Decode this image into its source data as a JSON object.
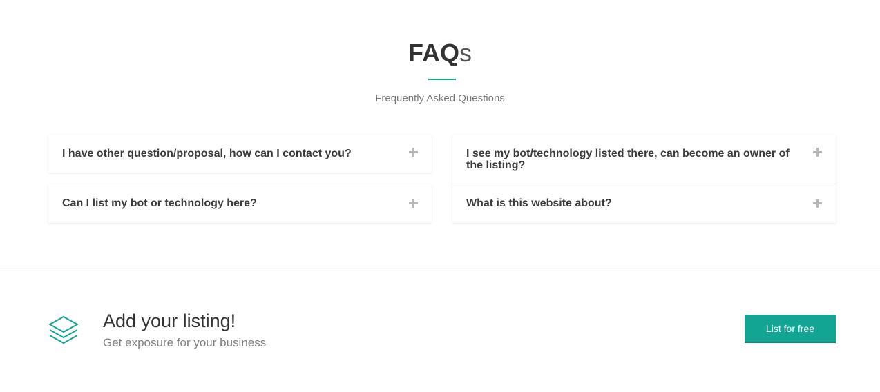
{
  "faq": {
    "title_strong": "FAQ",
    "title_light": "s",
    "subtitle": "Frequently Asked Questions",
    "left_items": [
      {
        "question": "I have other question/proposal, how can I contact you?"
      },
      {
        "question": "Can I list my bot or technology here?"
      }
    ],
    "right_items": [
      {
        "question": "I see my bot/technology listed there, can become an owner of the listing?"
      },
      {
        "question": "What is this website about?"
      }
    ]
  },
  "cta": {
    "icon": "layers-icon",
    "title": "Add your listing!",
    "subtitle": "Get exposure for your business",
    "button_label": "List for free"
  },
  "colors": {
    "accent": "#12a594",
    "text": "#333333",
    "muted": "#7a7a7a",
    "plus": "#b9b9b9"
  }
}
